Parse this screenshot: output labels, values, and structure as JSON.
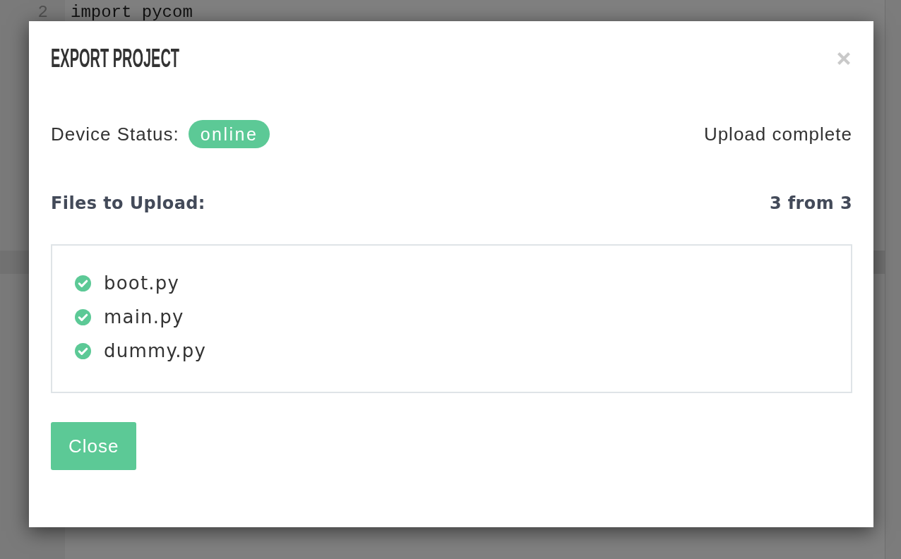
{
  "editor": {
    "lines": [
      {
        "number": "2",
        "code": "import pycom"
      }
    ]
  },
  "dialog": {
    "title": "EXPORT PROJECT",
    "device_status": {
      "label": "Device Status:",
      "badge": "online",
      "message": "Upload complete"
    },
    "files": {
      "label": "Files to Upload:",
      "count": "3 from 3",
      "items": [
        {
          "name": "boot.py",
          "checked": true
        },
        {
          "name": "main.py",
          "checked": true
        },
        {
          "name": "dummy.py",
          "checked": true
        }
      ]
    },
    "buttons": [
      {
        "label": "Close"
      }
    ]
  }
}
